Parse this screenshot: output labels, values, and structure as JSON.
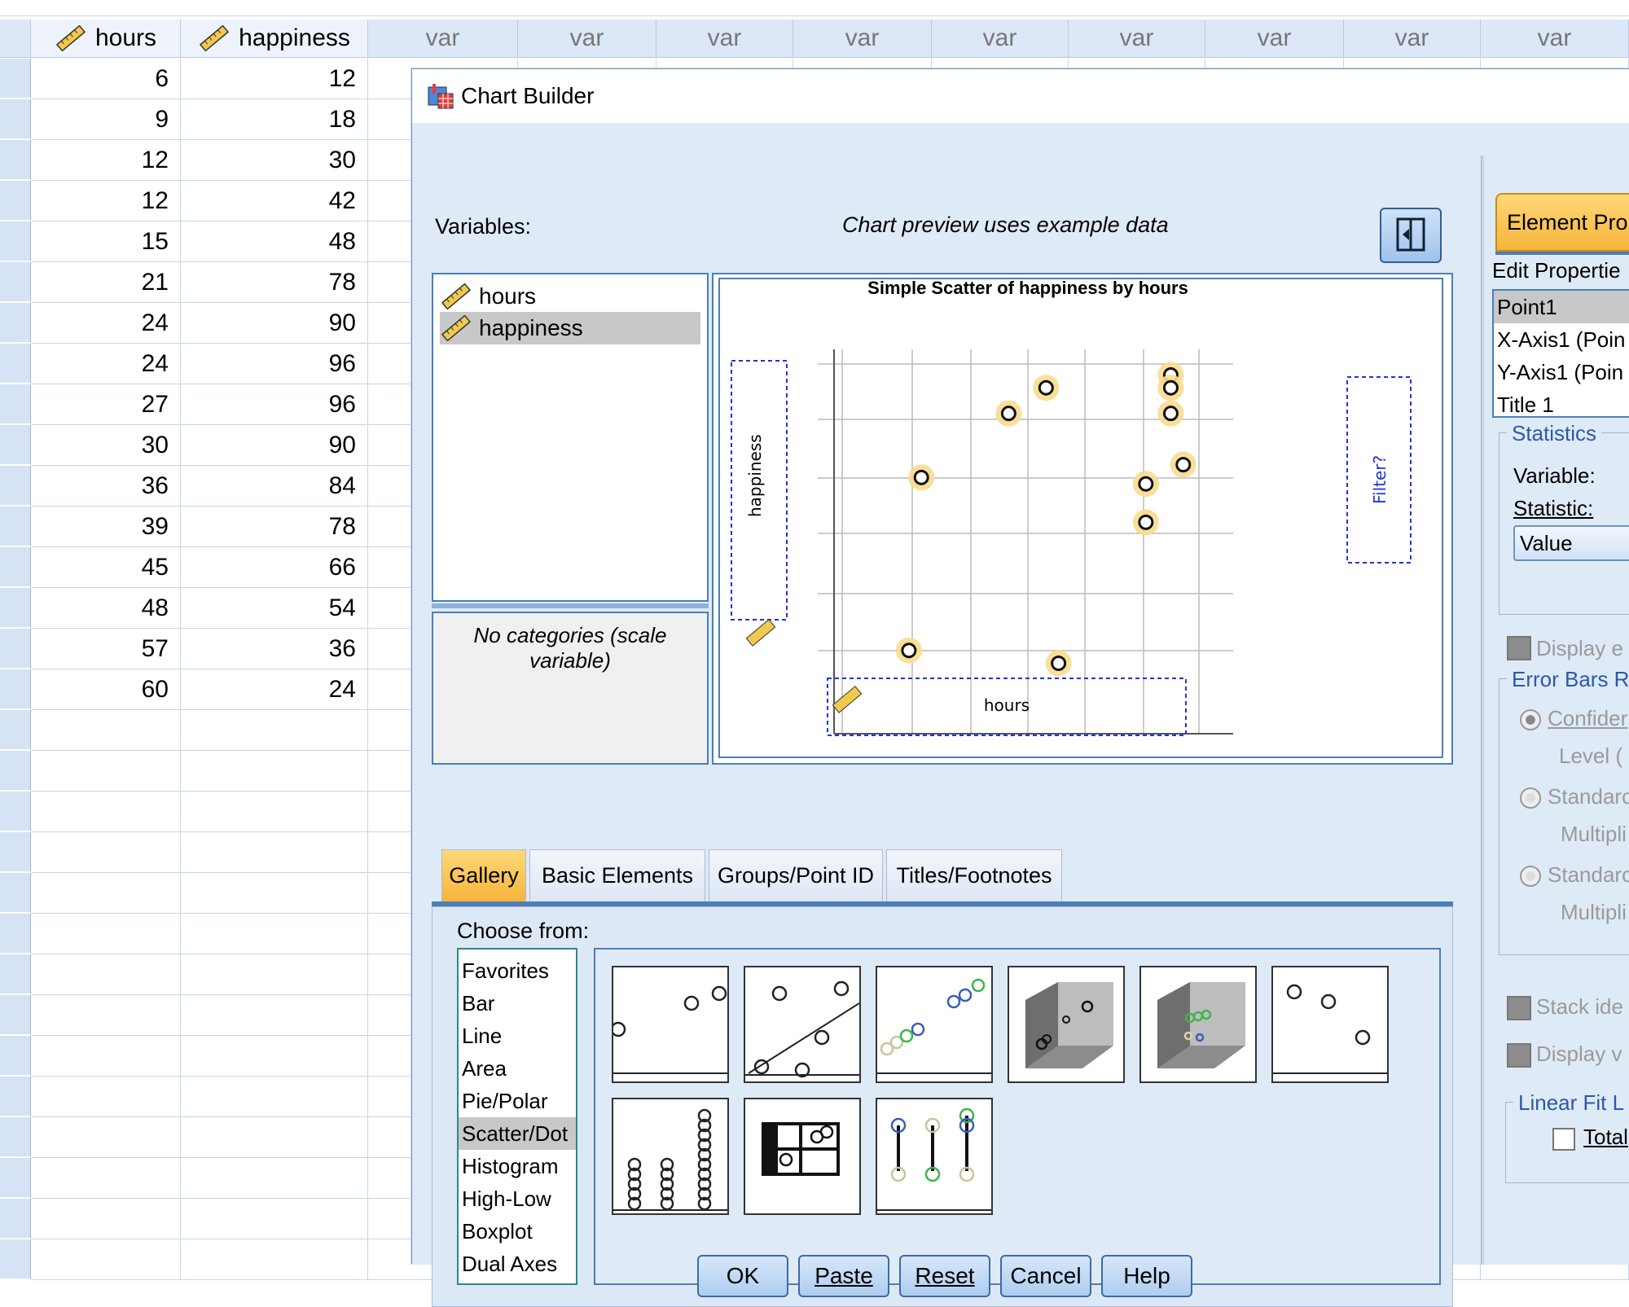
{
  "grid": {
    "columns": [
      {
        "name": "hours"
      },
      {
        "name": "happiness"
      },
      {
        "name": "var"
      },
      {
        "name": "var"
      },
      {
        "name": "var"
      },
      {
        "name": "var"
      },
      {
        "name": "var"
      },
      {
        "name": "var"
      },
      {
        "name": "var"
      },
      {
        "name": "var"
      },
      {
        "name": "var"
      }
    ],
    "rows": [
      [
        "6",
        "12"
      ],
      [
        "9",
        "18"
      ],
      [
        "12",
        "30"
      ],
      [
        "12",
        "42"
      ],
      [
        "15",
        "48"
      ],
      [
        "21",
        "78"
      ],
      [
        "24",
        "90"
      ],
      [
        "24",
        "96"
      ],
      [
        "27",
        "96"
      ],
      [
        "30",
        "90"
      ],
      [
        "36",
        "84"
      ],
      [
        "39",
        "78"
      ],
      [
        "45",
        "66"
      ],
      [
        "48",
        "54"
      ],
      [
        "57",
        "36"
      ],
      [
        "60",
        "24"
      ]
    ]
  },
  "dialog": {
    "title": "Chart Builder",
    "variables_label": "Variables:",
    "preview_note": "Chart preview uses example data",
    "variables": [
      "hours",
      "happiness"
    ],
    "no_categories": "No categories (scale variable)",
    "chart_title": "Simple Scatter of happiness by hours",
    "y_drop_label": "happiness",
    "x_drop_label": "hours",
    "filter_label": "Filter?",
    "tabs": [
      "Gallery",
      "Basic Elements",
      "Groups/Point ID",
      "Titles/Footnotes"
    ],
    "choose_from_label": "Choose from:",
    "choose_items": [
      "Favorites",
      "Bar",
      "Line",
      "Area",
      "Pie/Polar",
      "Scatter/Dot",
      "Histogram",
      "High-Low",
      "Boxplot",
      "Dual Axes"
    ],
    "selected_choice": "Scatter/Dot",
    "buttons": [
      "OK",
      "Paste",
      "Reset",
      "Cancel",
      "Help"
    ]
  },
  "element_properties": {
    "tab_label": "Element Prop",
    "edit_properties_label": "Edit Propertie",
    "list": [
      "Point1",
      "X-Axis1 (Poin",
      "Y-Axis1 (Poin",
      "Title 1"
    ],
    "statistics_label": "Statistics",
    "variable_label": "Variable:",
    "statistic_label": "Statistic:",
    "statistic_value": "Value",
    "display_e": "Display e",
    "error_bars_label": "Error Bars R",
    "confidence": "Confider",
    "level": "Level (",
    "standard1": "Standarc",
    "multiplier1": "Multipli",
    "standard2": "Standarc",
    "multiplier2": "Multipli",
    "stack": "Stack ide",
    "display_v": "Display v",
    "linear_fit": "Linear Fit L",
    "total": "Total"
  },
  "colors": {
    "accent_tab": "#f5b53a",
    "panel_border": "#4a7fb8",
    "dialog_bg": "#dfeaf7",
    "grid_header": "#dce8f7",
    "point_highlight": "#f9dc8e"
  },
  "chart_data": {
    "type": "scatter",
    "title": "Simple Scatter of happiness by hours",
    "xlabel": "hours",
    "ylabel": "happiness",
    "note": "Chart preview uses example data",
    "points": [
      {
        "x": 3.6,
        "y": 1.3
      },
      {
        "x": 3.7,
        "y": 4.0
      },
      {
        "x": 4.4,
        "y": 5.0
      },
      {
        "x": 4.7,
        "y": 5.4
      },
      {
        "x": 4.8,
        "y": 1.1
      },
      {
        "x": 5.5,
        "y": 3.9
      },
      {
        "x": 5.5,
        "y": 3.3
      },
      {
        "x": 5.7,
        "y": 5.6
      },
      {
        "x": 5.7,
        "y": 5.4
      },
      {
        "x": 5.7,
        "y": 5.0
      },
      {
        "x": 5.8,
        "y": 4.2
      }
    ],
    "xlim": [
      3,
      6.2
    ],
    "ylim": [
      0,
      6
    ],
    "grid": true
  }
}
